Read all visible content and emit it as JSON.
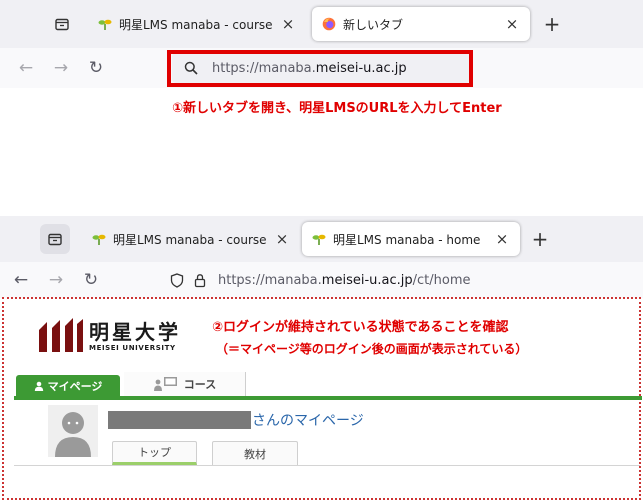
{
  "top_browser": {
    "tabs": [
      {
        "label": "明星LMS manaba - course",
        "close": "×"
      },
      {
        "label": "新しいタブ",
        "close": "×"
      }
    ],
    "new_tab": "+",
    "nav": {
      "back": "←",
      "forward": "→",
      "reload": "↻"
    },
    "url": {
      "prefix": "https://manaba.",
      "host": "meisei-u.ac.jp",
      "suffix": ""
    }
  },
  "annotation_1": "①新しいタブを開き、明星LMSのURLを入力してEnter",
  "bottom_browser": {
    "tabs": [
      {
        "label": "明星LMS manaba - course",
        "close": "×"
      },
      {
        "label": "明星LMS manaba - home",
        "close": "×"
      }
    ],
    "new_tab": "+",
    "nav": {
      "back": "←",
      "forward": "→",
      "reload": "↻"
    },
    "url": {
      "prefix": "https://manaba.",
      "host": "meisei-u.ac.jp",
      "suffix": "/ct/home"
    }
  },
  "manaba": {
    "logo": {
      "name": "明星大学",
      "sub": "MEISEI UNIVERSITY"
    },
    "main_tabs": [
      {
        "label": "マイページ",
        "icon": "person-icon"
      },
      {
        "label": "コース",
        "icon": "course-icon"
      }
    ],
    "user_suffix": "さんのマイページ",
    "sub_tabs": [
      {
        "label": "トップ"
      },
      {
        "label": "教材"
      }
    ]
  },
  "annotation_2": {
    "line1": "②ログインが維持されている状態であることを確認",
    "line2": "（＝マイページ等のログイン後の画面が表示されている）"
  },
  "colors": {
    "annotation_red": "#e00000",
    "manaba_green": "#3d9a34",
    "logo_maroon": "#7a1010"
  }
}
